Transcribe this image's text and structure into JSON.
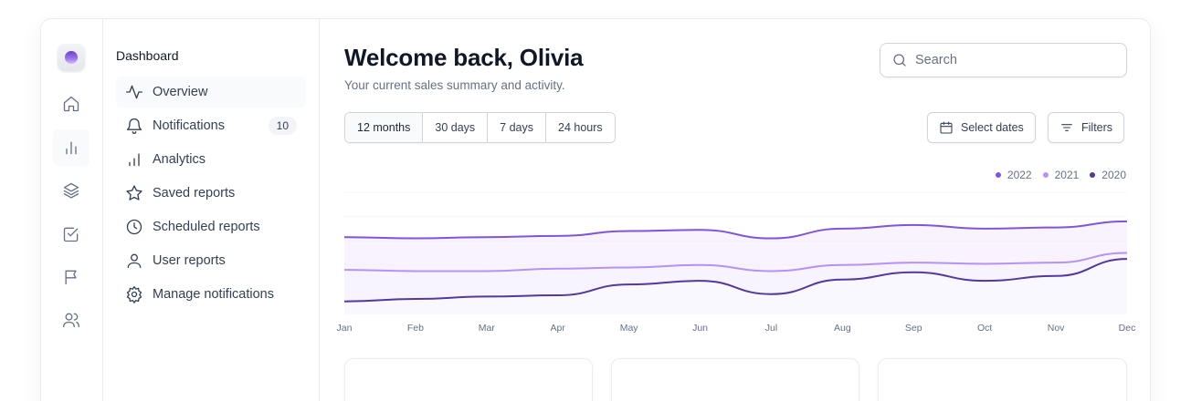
{
  "sidebar": {
    "section_title": "Dashboard",
    "items": [
      {
        "label": "Overview",
        "icon": "activity-icon"
      },
      {
        "label": "Notifications",
        "icon": "bell-icon",
        "badge": "10"
      },
      {
        "label": "Analytics",
        "icon": "bar-chart-icon"
      },
      {
        "label": "Saved reports",
        "icon": "star-icon"
      },
      {
        "label": "Scheduled reports",
        "icon": "clock-icon"
      },
      {
        "label": "User reports",
        "icon": "user-icon"
      },
      {
        "label": "Manage notifications",
        "icon": "gear-icon"
      }
    ]
  },
  "rail": {
    "icons": [
      "home-icon",
      "bar-chart-icon",
      "layers-icon",
      "check-square-icon",
      "flag-icon",
      "users-icon"
    ]
  },
  "header": {
    "title": "Welcome back, Olivia",
    "subtitle": "Your current sales summary and activity."
  },
  "search": {
    "placeholder": "Search"
  },
  "range_tabs": [
    "12 months",
    "30 days",
    "7 days",
    "24 hours"
  ],
  "actions": {
    "select_dates": "Select dates",
    "filters": "Filters"
  },
  "colors": {
    "accent": "#7f56d9",
    "light": "#b692f6",
    "dark": "#53389e",
    "border": "#d0d5dd"
  },
  "chart_data": {
    "type": "line",
    "categories": [
      "Jan",
      "Feb",
      "Mar",
      "Apr",
      "May",
      "Jun",
      "Jul",
      "Aug",
      "Sep",
      "Oct",
      "Nov",
      "Dec"
    ],
    "series": [
      {
        "name": "2022",
        "color": "#7f56d9",
        "values": [
          63,
          62,
          63,
          64,
          68,
          69,
          62,
          70,
          73,
          70,
          71,
          76
        ]
      },
      {
        "name": "2021",
        "color": "#b692f6",
        "values": [
          36,
          35,
          35,
          37,
          38,
          40,
          35,
          40,
          42,
          41,
          42,
          50
        ]
      },
      {
        "name": "2020",
        "color": "#53389e",
        "values": [
          10,
          12,
          14,
          15,
          24,
          27,
          16,
          28,
          34,
          27,
          31,
          45
        ]
      }
    ],
    "ylim": [
      0,
      100
    ],
    "grid": true,
    "legend": "top-right"
  }
}
